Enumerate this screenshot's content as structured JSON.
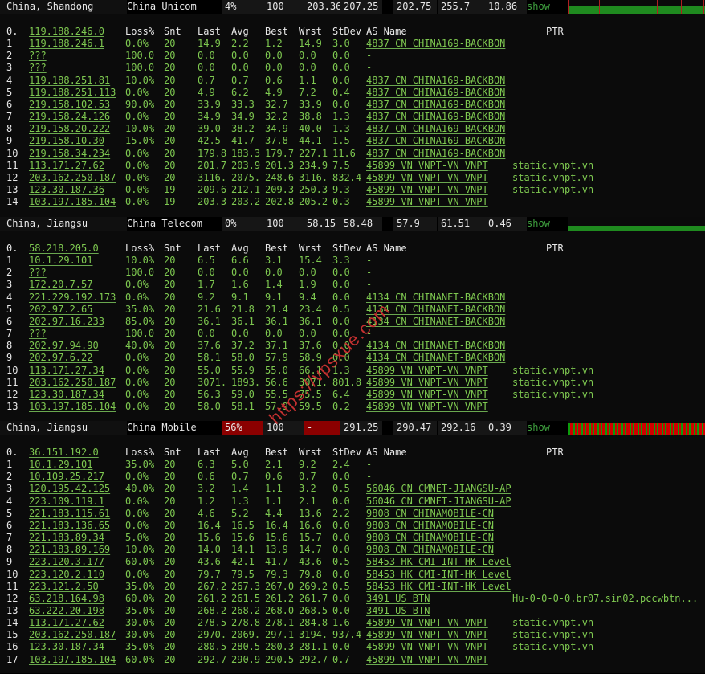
{
  "columns": {
    "num": "0.",
    "loss": "Loss%",
    "snt": "Snt",
    "last": "Last",
    "avg": "Avg",
    "best": "Best",
    "wrst": "Wrst",
    "stdev": "StDev",
    "as": "AS Name",
    "ptr": "PTR"
  },
  "colors": {
    "good": "#1f8a1f",
    "bad": "#8b0000",
    "link": "#7ec850",
    "text": "#e8e8e8",
    "watermark": "#c43030"
  },
  "watermark": "https://vpsxue.com",
  "tests": [
    {
      "location": "China, Shandong",
      "isp": "China Unicom",
      "loss": "4%",
      "snt": "100",
      "last": "203.36",
      "avg": "207.25",
      "best": "202.75",
      "wrst": "255.7",
      "stdev": "10.86",
      "action": "show",
      "loss_level": "low",
      "hops": [
        {
          "hop": "0.",
          "ip": "119.188.246.0",
          "loss": "Loss%",
          "snt": "Snt",
          "last": "Last",
          "avg": "Avg",
          "best": "Best",
          "wrst": "Wrst",
          "stdev": "StDev",
          "as": "AS Name",
          "ptr": "PTR",
          "header": true
        },
        {
          "hop": "1",
          "ip": "119.188.246.1",
          "loss": "0.0%",
          "snt": "20",
          "last": "14.9",
          "avg": "2.2",
          "best": "1.2",
          "wrst": "14.9",
          "stdev": "3.0",
          "as": "4837  CN  CHINA169-BACKBON",
          "ptr": ""
        },
        {
          "hop": "2",
          "ip": "???",
          "loss": "100.0",
          "snt": "20",
          "last": "0.0",
          "avg": "0.0",
          "best": "0.0",
          "wrst": "0.0",
          "stdev": "0.0",
          "as": "-",
          "ptr": ""
        },
        {
          "hop": "3",
          "ip": "???",
          "loss": "100.0",
          "snt": "20",
          "last": "0.0",
          "avg": "0.0",
          "best": "0.0",
          "wrst": "0.0",
          "stdev": "0.0",
          "as": "-",
          "ptr": ""
        },
        {
          "hop": "4",
          "ip": "119.188.251.81",
          "loss": "10.0%",
          "snt": "20",
          "last": "0.7",
          "avg": "0.7",
          "best": "0.6",
          "wrst": "1.1",
          "stdev": "0.0",
          "as": "4837  CN  CHINA169-BACKBON",
          "ptr": ""
        },
        {
          "hop": "5",
          "ip": "119.188.251.113",
          "loss": "0.0%",
          "snt": "20",
          "last": "4.9",
          "avg": "6.2",
          "best": "4.9",
          "wrst": "7.2",
          "stdev": "0.4",
          "as": "4837  CN  CHINA169-BACKBON",
          "ptr": ""
        },
        {
          "hop": "6",
          "ip": "219.158.102.53",
          "loss": "90.0%",
          "snt": "20",
          "last": "33.9",
          "avg": "33.3",
          "best": "32.7",
          "wrst": "33.9",
          "stdev": "0.0",
          "as": "4837  CN  CHINA169-BACKBON",
          "ptr": ""
        },
        {
          "hop": "7",
          "ip": "219.158.24.126",
          "loss": "0.0%",
          "snt": "20",
          "last": "34.9",
          "avg": "34.9",
          "best": "32.2",
          "wrst": "38.8",
          "stdev": "1.3",
          "as": "4837  CN  CHINA169-BACKBON",
          "ptr": ""
        },
        {
          "hop": "8",
          "ip": "219.158.20.222",
          "loss": "10.0%",
          "snt": "20",
          "last": "39.0",
          "avg": "38.2",
          "best": "34.9",
          "wrst": "40.0",
          "stdev": "1.3",
          "as": "4837  CN  CHINA169-BACKBON",
          "ptr": ""
        },
        {
          "hop": "9",
          "ip": "219.158.10.30",
          "loss": "15.0%",
          "snt": "20",
          "last": "42.5",
          "avg": "41.7",
          "best": "37.8",
          "wrst": "44.1",
          "stdev": "1.5",
          "as": "4837  CN  CHINA169-BACKBON",
          "ptr": ""
        },
        {
          "hop": "10",
          "ip": "219.158.34.234",
          "loss": "0.0%",
          "snt": "20",
          "last": "179.8",
          "avg": "183.3",
          "best": "179.7",
          "wrst": "227.1",
          "stdev": "11.6",
          "as": "4837  CN  CHINA169-BACKBON",
          "ptr": ""
        },
        {
          "hop": "11",
          "ip": "113.171.27.62",
          "loss": "0.0%",
          "snt": "20",
          "last": "201.7",
          "avg": "203.9",
          "best": "201.3",
          "wrst": "234.9",
          "stdev": "7.5",
          "as": "45899 VN  VNPT-VN VNPT",
          "ptr": "static.vnpt.vn"
        },
        {
          "hop": "12",
          "ip": "203.162.250.187",
          "loss": "0.0%",
          "snt": "20",
          "last": "3116.",
          "avg": "2075.",
          "best": "248.6",
          "wrst": "3116.",
          "stdev": "832.4",
          "as": "45899 VN  VNPT-VN VNPT",
          "ptr": "static.vnpt.vn"
        },
        {
          "hop": "13",
          "ip": "123.30.187.36",
          "loss": "0.0%",
          "snt": "19",
          "last": "209.6",
          "avg": "212.1",
          "best": "209.3",
          "wrst": "250.3",
          "stdev": "9.3",
          "as": "45899 VN  VNPT-VN VNPT",
          "ptr": "static.vnpt.vn"
        },
        {
          "hop": "14",
          "ip": "103.197.185.104",
          "loss": "0.0%",
          "snt": "19",
          "last": "203.3",
          "avg": "203.2",
          "best": "202.8",
          "wrst": "205.2",
          "stdev": "0.3",
          "as": "45899 VN  VNPT-VN VNPT",
          "ptr": ""
        }
      ]
    },
    {
      "location": "China, Jiangsu",
      "isp": "China Telecom",
      "loss": "0%",
      "snt": "100",
      "last": "58.15",
      "avg": "58.48",
      "best": "57.9",
      "wrst": "61.51",
      "stdev": "0.46",
      "action": "show",
      "loss_level": "none",
      "hops": [
        {
          "hop": "0.",
          "ip": "58.218.205.0",
          "loss": "Loss%",
          "snt": "Snt",
          "last": "Last",
          "avg": "Avg",
          "best": "Best",
          "wrst": "Wrst",
          "stdev": "StDev",
          "as": "AS Name",
          "ptr": "PTR",
          "header": true
        },
        {
          "hop": "1",
          "ip": "10.1.29.101",
          "loss": "10.0%",
          "snt": "20",
          "last": "6.5",
          "avg": "6.6",
          "best": "3.1",
          "wrst": "15.4",
          "stdev": "3.3",
          "as": "-",
          "ptr": ""
        },
        {
          "hop": "2",
          "ip": "???",
          "loss": "100.0",
          "snt": "20",
          "last": "0.0",
          "avg": "0.0",
          "best": "0.0",
          "wrst": "0.0",
          "stdev": "0.0",
          "as": "-",
          "ptr": ""
        },
        {
          "hop": "3",
          "ip": "172.20.7.57",
          "loss": "0.0%",
          "snt": "20",
          "last": "1.7",
          "avg": "1.6",
          "best": "1.4",
          "wrst": "1.9",
          "stdev": "0.0",
          "as": "-",
          "ptr": ""
        },
        {
          "hop": "4",
          "ip": "221.229.192.173",
          "loss": "0.0%",
          "snt": "20",
          "last": "9.2",
          "avg": "9.1",
          "best": "9.1",
          "wrst": "9.4",
          "stdev": "0.0",
          "as": "4134  CN  CHINANET-BACKBON",
          "ptr": ""
        },
        {
          "hop": "5",
          "ip": "202.97.2.65",
          "loss": "35.0%",
          "snt": "20",
          "last": "21.6",
          "avg": "21.8",
          "best": "21.4",
          "wrst": "23.4",
          "stdev": "0.5",
          "as": "4134  CN  CHINANET-BACKBON",
          "ptr": ""
        },
        {
          "hop": "6",
          "ip": "202.97.16.233",
          "loss": "85.0%",
          "snt": "20",
          "last": "36.1",
          "avg": "36.1",
          "best": "36.1",
          "wrst": "36.1",
          "stdev": "0.0",
          "as": "4134  CN  CHINANET-BACKBON",
          "ptr": ""
        },
        {
          "hop": "7",
          "ip": "???",
          "loss": "100.0",
          "snt": "20",
          "last": "0.0",
          "avg": "0.0",
          "best": "0.0",
          "wrst": "0.0",
          "stdev": "0.0",
          "as": "-",
          "ptr": ""
        },
        {
          "hop": "8",
          "ip": "202.97.94.90",
          "loss": "40.0%",
          "snt": "20",
          "last": "37.6",
          "avg": "37.2",
          "best": "37.1",
          "wrst": "37.6",
          "stdev": "0.0",
          "as": "4134  CN  CHINANET-BACKBON",
          "ptr": ""
        },
        {
          "hop": "9",
          "ip": "202.97.6.22",
          "loss": "0.0%",
          "snt": "20",
          "last": "58.1",
          "avg": "58.0",
          "best": "57.9",
          "wrst": "58.9",
          "stdev": "0.0",
          "as": "4134  CN  CHINANET-BACKBON",
          "ptr": ""
        },
        {
          "hop": "10",
          "ip": "113.171.27.34",
          "loss": "0.0%",
          "snt": "20",
          "last": "55.0",
          "avg": "55.9",
          "best": "55.0",
          "wrst": "66.1",
          "stdev": "1.3",
          "as": "45899 VN  VNPT-VN VNPT",
          "ptr": "static.vnpt.vn"
        },
        {
          "hop": "11",
          "ip": "203.162.250.187",
          "loss": "0.0%",
          "snt": "20",
          "last": "3071.",
          "avg": "1893.",
          "best": "56.6",
          "wrst": "3071.",
          "stdev": "801.8",
          "as": "45899 VN  VNPT-VN VNPT",
          "ptr": "static.vnpt.vn"
        },
        {
          "hop": "12",
          "ip": "123.30.187.34",
          "loss": "0.0%",
          "snt": "20",
          "last": "56.3",
          "avg": "59.0",
          "best": "55.5",
          "wrst": "75.5",
          "stdev": "6.4",
          "as": "45899 VN  VNPT-VN VNPT",
          "ptr": "static.vnpt.vn"
        },
        {
          "hop": "13",
          "ip": "103.197.185.104",
          "loss": "0.0%",
          "snt": "20",
          "last": "58.0",
          "avg": "58.1",
          "best": "57.9",
          "wrst": "59.5",
          "stdev": "0.2",
          "as": "45899 VN  VNPT-VN VNPT",
          "ptr": ""
        }
      ]
    },
    {
      "location": "China, Jiangsu",
      "isp": "China Mobile",
      "loss": "56%",
      "snt": "100",
      "last": "-",
      "avg": "291.25",
      "best": "290.47",
      "wrst": "292.16",
      "stdev": "0.39",
      "action": "show",
      "loss_level": "high",
      "hops": [
        {
          "hop": "0.",
          "ip": "36.151.192.0",
          "loss": "Loss%",
          "snt": "Snt",
          "last": "Last",
          "avg": "Avg",
          "best": "Best",
          "wrst": "Wrst",
          "stdev": "StDev",
          "as": "AS Name",
          "ptr": "PTR",
          "header": true
        },
        {
          "hop": "1",
          "ip": "10.1.29.101",
          "loss": "35.0%",
          "snt": "20",
          "last": "6.3",
          "avg": "5.0",
          "best": "2.1",
          "wrst": "9.2",
          "stdev": "2.4",
          "as": "-",
          "ptr": ""
        },
        {
          "hop": "2",
          "ip": "10.109.25.217",
          "loss": "0.0%",
          "snt": "20",
          "last": "0.6",
          "avg": "0.7",
          "best": "0.6",
          "wrst": "0.7",
          "stdev": "0.0",
          "as": "-",
          "ptr": ""
        },
        {
          "hop": "3",
          "ip": "120.195.42.125",
          "loss": "40.0%",
          "snt": "20",
          "last": "3.2",
          "avg": "1.4",
          "best": "1.1",
          "wrst": "3.2",
          "stdev": "0.5",
          "as": "56046 CN  CMNET-JIANGSU-AP",
          "ptr": ""
        },
        {
          "hop": "4",
          "ip": "223.109.119.1",
          "loss": "0.0%",
          "snt": "20",
          "last": "1.2",
          "avg": "1.3",
          "best": "1.1",
          "wrst": "2.1",
          "stdev": "0.0",
          "as": "56046 CN  CMNET-JIANGSU-AP",
          "ptr": ""
        },
        {
          "hop": "5",
          "ip": "221.183.115.61",
          "loss": "0.0%",
          "snt": "20",
          "last": "4.6",
          "avg": "5.2",
          "best": "4.4",
          "wrst": "13.6",
          "stdev": "2.2",
          "as": "9808  CN  CHINAMOBILE-CN",
          "ptr": ""
        },
        {
          "hop": "6",
          "ip": "221.183.136.65",
          "loss": "0.0%",
          "snt": "20",
          "last": "16.4",
          "avg": "16.5",
          "best": "16.4",
          "wrst": "16.6",
          "stdev": "0.0",
          "as": "9808  CN  CHINAMOBILE-CN",
          "ptr": ""
        },
        {
          "hop": "7",
          "ip": "221.183.89.34",
          "loss": "5.0%",
          "snt": "20",
          "last": "15.6",
          "avg": "15.6",
          "best": "15.6",
          "wrst": "15.7",
          "stdev": "0.0",
          "as": "9808  CN  CHINAMOBILE-CN",
          "ptr": ""
        },
        {
          "hop": "8",
          "ip": "221.183.89.169",
          "loss": "10.0%",
          "snt": "20",
          "last": "14.0",
          "avg": "14.1",
          "best": "13.9",
          "wrst": "14.7",
          "stdev": "0.0",
          "as": "9808  CN  CHINAMOBILE-CN",
          "ptr": ""
        },
        {
          "hop": "9",
          "ip": "223.120.3.177",
          "loss": "60.0%",
          "snt": "20",
          "last": "43.6",
          "avg": "42.1",
          "best": "41.7",
          "wrst": "43.6",
          "stdev": "0.5",
          "as": "58453 HK  CMI-INT-HK Level",
          "ptr": ""
        },
        {
          "hop": "10",
          "ip": "223.120.2.110",
          "loss": "0.0%",
          "snt": "20",
          "last": "79.7",
          "avg": "79.5",
          "best": "79.3",
          "wrst": "79.8",
          "stdev": "0.0",
          "as": "58453 HK  CMI-INT-HK Level",
          "ptr": ""
        },
        {
          "hop": "11",
          "ip": "223.121.2.50",
          "loss": "35.0%",
          "snt": "20",
          "last": "267.2",
          "avg": "267.3",
          "best": "267.0",
          "wrst": "269.2",
          "stdev": "0.5",
          "as": "58453 HK  CMI-INT-HK Level",
          "ptr": ""
        },
        {
          "hop": "12",
          "ip": "63.218.164.98",
          "loss": "60.0%",
          "snt": "20",
          "last": "261.2",
          "avg": "261.5",
          "best": "261.2",
          "wrst": "261.7",
          "stdev": "0.0",
          "as": "3491  US  BTN",
          "ptr": "Hu-0-0-0-0.br07.sin02.pccwbtn..."
        },
        {
          "hop": "13",
          "ip": "63.222.20.198",
          "loss": "35.0%",
          "snt": "20",
          "last": "268.2",
          "avg": "268.2",
          "best": "268.0",
          "wrst": "268.5",
          "stdev": "0.0",
          "as": "3491  US  BTN",
          "ptr": ""
        },
        {
          "hop": "14",
          "ip": "113.171.27.62",
          "loss": "30.0%",
          "snt": "20",
          "last": "278.5",
          "avg": "278.8",
          "best": "278.1",
          "wrst": "284.8",
          "stdev": "1.6",
          "as": "45899 VN  VNPT-VN VNPT",
          "ptr": "static.vnpt.vn"
        },
        {
          "hop": "15",
          "ip": "203.162.250.187",
          "loss": "30.0%",
          "snt": "20",
          "last": "2970.",
          "avg": "2069.",
          "best": "297.1",
          "wrst": "3194.",
          "stdev": "937.4",
          "as": "45899 VN  VNPT-VN VNPT",
          "ptr": "static.vnpt.vn"
        },
        {
          "hop": "16",
          "ip": "123.30.187.34",
          "loss": "35.0%",
          "snt": "20",
          "last": "280.5",
          "avg": "280.5",
          "best": "280.3",
          "wrst": "281.1",
          "stdev": "0.0",
          "as": "45899 VN  VNPT-VN VNPT",
          "ptr": "static.vnpt.vn"
        },
        {
          "hop": "17",
          "ip": "103.197.185.104",
          "loss": "60.0%",
          "snt": "20",
          "last": "292.7",
          "avg": "290.9",
          "best": "290.5",
          "wrst": "292.7",
          "stdev": "0.7",
          "as": "45899 VN  VNPT-VN VNPT",
          "ptr": ""
        }
      ]
    }
  ]
}
